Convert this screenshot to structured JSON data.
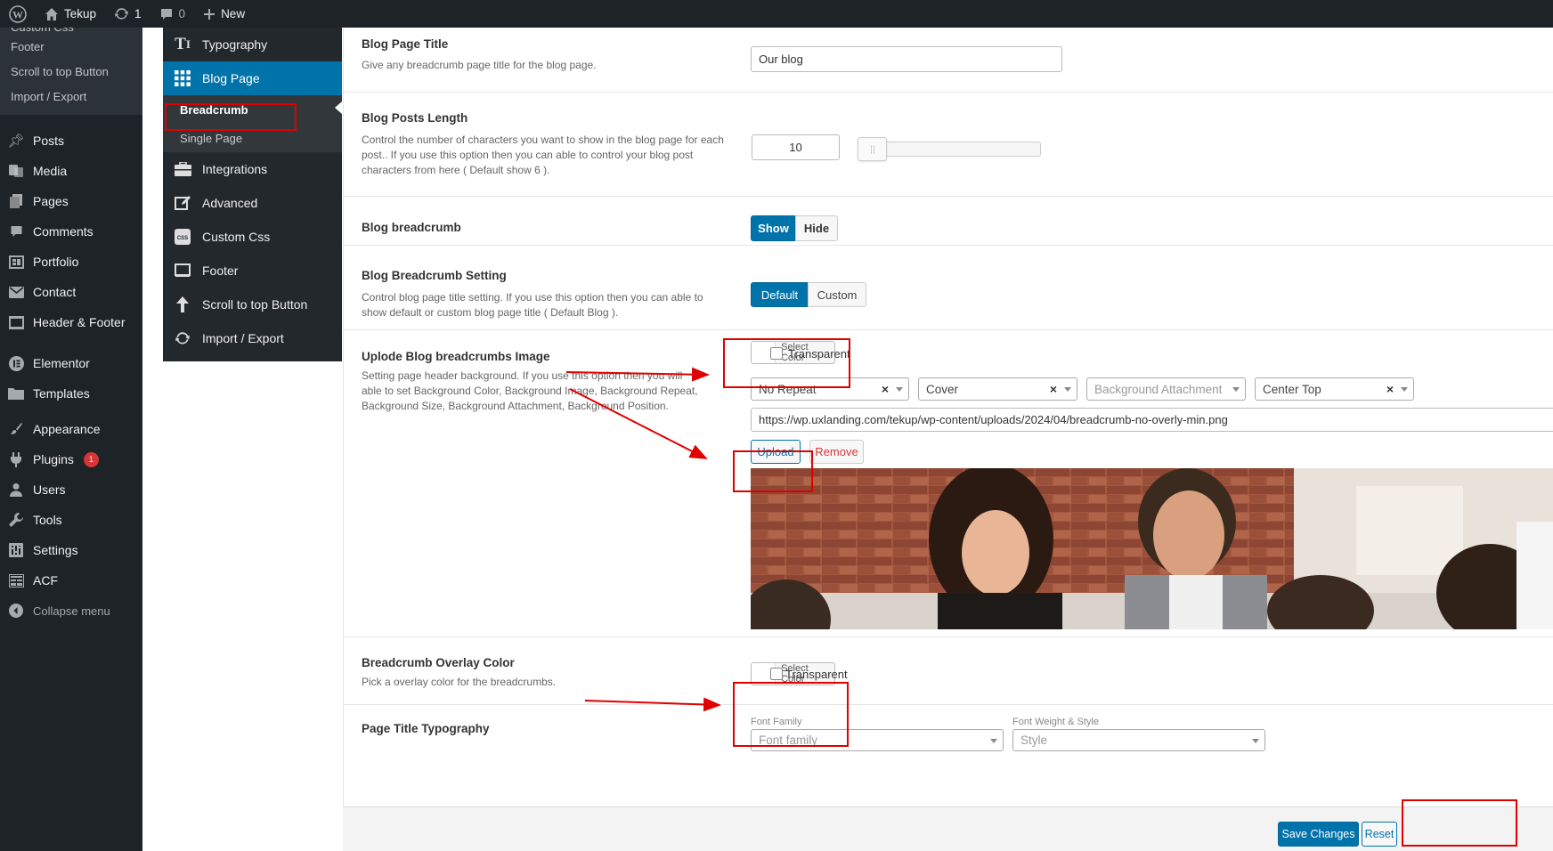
{
  "adminbar": {
    "site": "Tekup",
    "updates": "1",
    "comments": "0",
    "new": "New"
  },
  "menu": {
    "sub_items": [
      "Custom Css",
      "Footer",
      "Scroll to top Button",
      "Import / Export"
    ],
    "items": [
      {
        "label": "Posts",
        "icon": "pin-icon"
      },
      {
        "label": "Media",
        "icon": "media-icon"
      },
      {
        "label": "Pages",
        "icon": "pages-icon"
      },
      {
        "label": "Comments",
        "icon": "comments-icon"
      },
      {
        "label": "Portfolio",
        "icon": "portfolio-icon"
      },
      {
        "label": "Contact",
        "icon": "mail-icon"
      },
      {
        "label": "Header & Footer",
        "icon": "layout-icon"
      },
      {
        "label": "Elementor",
        "icon": "elementor-icon"
      },
      {
        "label": "Templates",
        "icon": "folder-icon"
      },
      {
        "label": "Appearance",
        "icon": "brush-icon"
      },
      {
        "label": "Plugins",
        "icon": "plug-icon",
        "badge": "1"
      },
      {
        "label": "Users",
        "icon": "user-icon"
      },
      {
        "label": "Tools",
        "icon": "wrench-icon"
      },
      {
        "label": "Settings",
        "icon": "settings-icon"
      },
      {
        "label": "ACF",
        "icon": "acf-icon"
      },
      {
        "label": "Collapse menu",
        "icon": "collapse-icon"
      }
    ]
  },
  "options_nav": {
    "typography": "Typography",
    "blog_page": "Blog Page",
    "breadcrumb": "Breadcrumb",
    "single_page": "Single Page",
    "integrations": "Integrations",
    "advanced": "Advanced",
    "custom_css": "Custom Css",
    "footer": "Footer",
    "scroll_top": "Scroll to top Button",
    "import_export": "Import / Export"
  },
  "fields": {
    "blog_title": {
      "label": "Blog Page Title",
      "desc": "Give any breadcrumb page title for the blog page.",
      "value": "Our blog"
    },
    "posts_length": {
      "label": "Blog Posts Length",
      "desc": "Control the number of characters you want to show in the blog page for each post.. If you use this option then you can able to control your blog post characters from here ( Default show 6 ).",
      "value": "10"
    },
    "breadcrumb": {
      "label": "Blog breadcrumb",
      "show": "Show",
      "hide": "Hide"
    },
    "breadcrumb_setting": {
      "label": "Blog Breadcrumb Setting",
      "desc": "Control blog page title setting. If you use this option then you can able to show default or custom blog page title ( Default Blog ).",
      "default": "Default",
      "custom": "Custom"
    },
    "breadcrumb_image": {
      "label": "Uplode Blog breadcrumbs Image",
      "desc": "Setting page header background. If you use this option then you will able to set Background Color, Background Image, Background Repeat, Background Size, Background Attachment, Background Position.",
      "select_color": "Select Color",
      "transparent": "Transparent",
      "repeat": "No Repeat",
      "size": "Cover",
      "attachment": "Background Attachment",
      "position": "Center Top",
      "url": "https://wp.uxlanding.com/tekup/wp-content/uploads/2024/04/breadcrumb-no-overly-min.png",
      "upload": "Upload",
      "remove": "Remove"
    },
    "overlay": {
      "label": "Breadcrumb Overlay Color",
      "desc": "Pick a overlay color for the breadcrumbs.",
      "select_color": "Select Color",
      "transparent": "Transparent"
    },
    "title_typo": {
      "label": "Page Title Typography",
      "family_label": "Font Family",
      "family_ph": "Font family",
      "weight_label": "Font Weight & Style",
      "weight_ph": "Style"
    }
  },
  "footer": {
    "save": "Save Changes",
    "reset": "Reset"
  }
}
